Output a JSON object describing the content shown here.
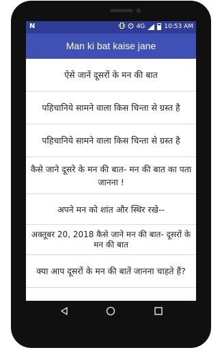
{
  "status_bar": {
    "left_icon": "N",
    "network": "4G",
    "time": "10:53 AM",
    "icons": [
      "vibrate-icon",
      "alarm-icon",
      "signal-icon",
      "battery-icon"
    ]
  },
  "app_bar": {
    "title": "Man ki bat kaise jane"
  },
  "list": {
    "items": [
      "ऐसे जानें दूसरों के मन की बात",
      "पहिचानिये सामने वाला किस चिन्ता से ग्रस्त है",
      "पहिचानिये सामने वाला किस चिन्ता से ग्रस्त है",
      "कैसे जाने दूसरे के मन की बात- मन की बात का पता जानना !",
      "अपने मन को शांत और स्थिर रखे--",
      "अक्तूबर 20, 2018 कैसे जाने मन की बात- दूसरों के मन की बात",
      "क्या आप दूसरों के मन की बातें जानना चाहते हैं?"
    ]
  },
  "nav_bar": {
    "icons": [
      "back-icon",
      "home-icon",
      "recents-icon"
    ]
  },
  "colors": {
    "status_bar": "#2f3d96",
    "app_bar": "#3f51b5",
    "phone": "#101010"
  }
}
